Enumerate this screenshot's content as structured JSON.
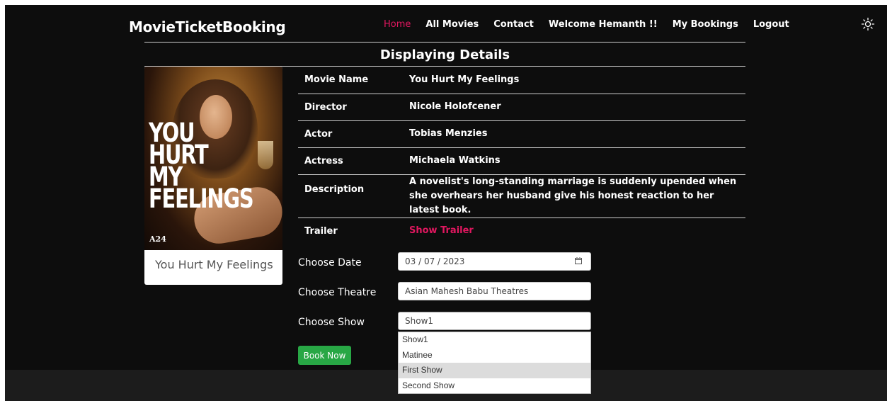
{
  "brand": "MovieTicketBooking",
  "nav": [
    "Home",
    "All Movies",
    "Contact",
    "Welcome Hemanth !!",
    "My Bookings",
    "Logout"
  ],
  "section_title": "Displaying Details",
  "movie": {
    "poster_title": [
      "YOU",
      "HURT",
      "MY",
      "FEELINGS"
    ],
    "poster_logo": "A24",
    "caption": "You Hurt My Feelings"
  },
  "details": [
    {
      "key": "Movie Name",
      "value": "You Hurt My Feelings"
    },
    {
      "key": "Director",
      "value": "Nicole Holofcener"
    },
    {
      "key": "Actor",
      "value": "Tobias Menzies"
    },
    {
      "key": "Actress",
      "value": "Michaela Watkins"
    },
    {
      "key": "Description",
      "value": "A novelist's long-standing marriage is suddenly upended when she overhears her husband give his honest reaction to her latest book."
    },
    {
      "key": "Trailer",
      "value": "Show Trailer"
    }
  ],
  "form": {
    "date_label": "Choose Date",
    "date_value": "03 / 07 / 2023",
    "theatre_label": "Choose Theatre",
    "theatre_value": "Asian Mahesh Babu Theatres",
    "show_label": "Choose Show",
    "show_value": "Show1",
    "show_options": [
      "Show1",
      "Matinee",
      "First Show",
      "Second Show"
    ],
    "book_label": "Book Now"
  },
  "colors": {
    "accent": "#e0175f",
    "button": "#28a745",
    "background": "#0d0d0d"
  }
}
